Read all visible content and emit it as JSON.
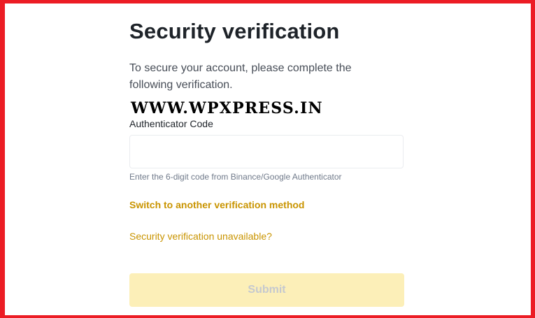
{
  "page": {
    "title": "Security verification",
    "subtitle": "To secure your account, please complete the following verification."
  },
  "watermark": {
    "text": "WWW.WPXPRESS.IN"
  },
  "form": {
    "field_label": "Authenticator Code",
    "field_value": "",
    "helper_text": "Enter the 6-digit code from Binance/Google Authenticator",
    "switch_method_link": "Switch to another verification method",
    "unavailable_link": "Security verification unavailable?",
    "submit_label": "Submit",
    "submit_disabled": true
  },
  "colors": {
    "frame_border": "#ec1c24",
    "accent_link": "#c99400",
    "submit_bg_disabled": "#fcefb8",
    "submit_text_disabled": "#c5c9cf",
    "title_text": "#1e2329",
    "body_text": "#474d57",
    "helper_text": "#707a8a",
    "input_border": "#eaecef"
  }
}
